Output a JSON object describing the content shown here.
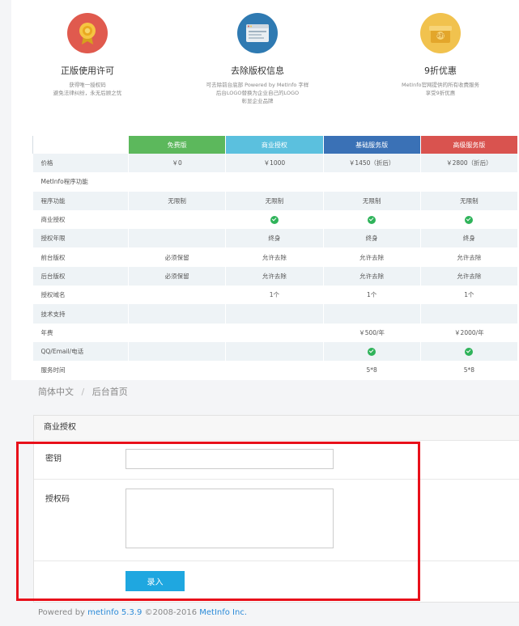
{
  "features": [
    {
      "icon": "badge-icon",
      "color": "#e05a4e",
      "title": "正版使用许可",
      "desc": [
        "获得唯一授权码",
        "避免法律纠纷，永无后顾之忧"
      ]
    },
    {
      "icon": "browser-window-icon",
      "color": "#2f7ab2",
      "title": "去除版权信息",
      "desc": [
        "可去除前台底部 Powered by MetInfo 字样",
        "后台LOGO替换为企业自己的LOGO",
        "彰显企业品牌"
      ]
    },
    {
      "icon": "gift-box-icon",
      "color": "#f1c24e",
      "title": "9折优惠",
      "desc": [
        "MetInfo官网提供的所有收费服务",
        "享受9折优惠"
      ]
    }
  ],
  "price_table": {
    "headers": [
      "",
      "免费版",
      "商业授权",
      "基础服务版",
      "高级服务版"
    ],
    "rows": [
      [
        "价格",
        "￥0",
        "￥1000",
        "￥1450（折后）",
        "￥2800（折后）"
      ],
      [
        "MetInfo程序功能",
        "",
        "",
        "",
        ""
      ],
      [
        "程序功能",
        "无限制",
        "无限制",
        "无限制",
        "无限制"
      ],
      [
        "商业授权",
        "",
        "✓",
        "✓",
        "✓"
      ],
      [
        "授权年限",
        "",
        "终身",
        "终身",
        "终身"
      ],
      [
        "前台版权",
        "必须保留",
        "允许去除",
        "允许去除",
        "允许去除"
      ],
      [
        "后台版权",
        "必须保留",
        "允许去除",
        "允许去除",
        "允许去除"
      ],
      [
        "授权域名",
        "",
        "1个",
        "1个",
        "1个"
      ],
      [
        "技术支持",
        "",
        "",
        "",
        ""
      ],
      [
        "年费",
        "",
        "",
        "￥500/年",
        "￥2000/年"
      ],
      [
        "QQ/Email/电话",
        "",
        "",
        "✓",
        "✓"
      ],
      [
        "服务时间",
        "",
        "",
        "5*8",
        "5*8"
      ]
    ]
  },
  "breadcrumb": {
    "language": "简体中文",
    "separator": "/",
    "page": "后台首页"
  },
  "form": {
    "title": "商业授权",
    "key_label": "密钥",
    "key_value": "",
    "code_label": "授权码",
    "code_value": "",
    "submit_label": "录入"
  },
  "footer": {
    "prefix": "Powered by",
    "product": "metinfo 5.3.9",
    "copyright": "©2008-2016",
    "company": "MetInfo Inc."
  }
}
